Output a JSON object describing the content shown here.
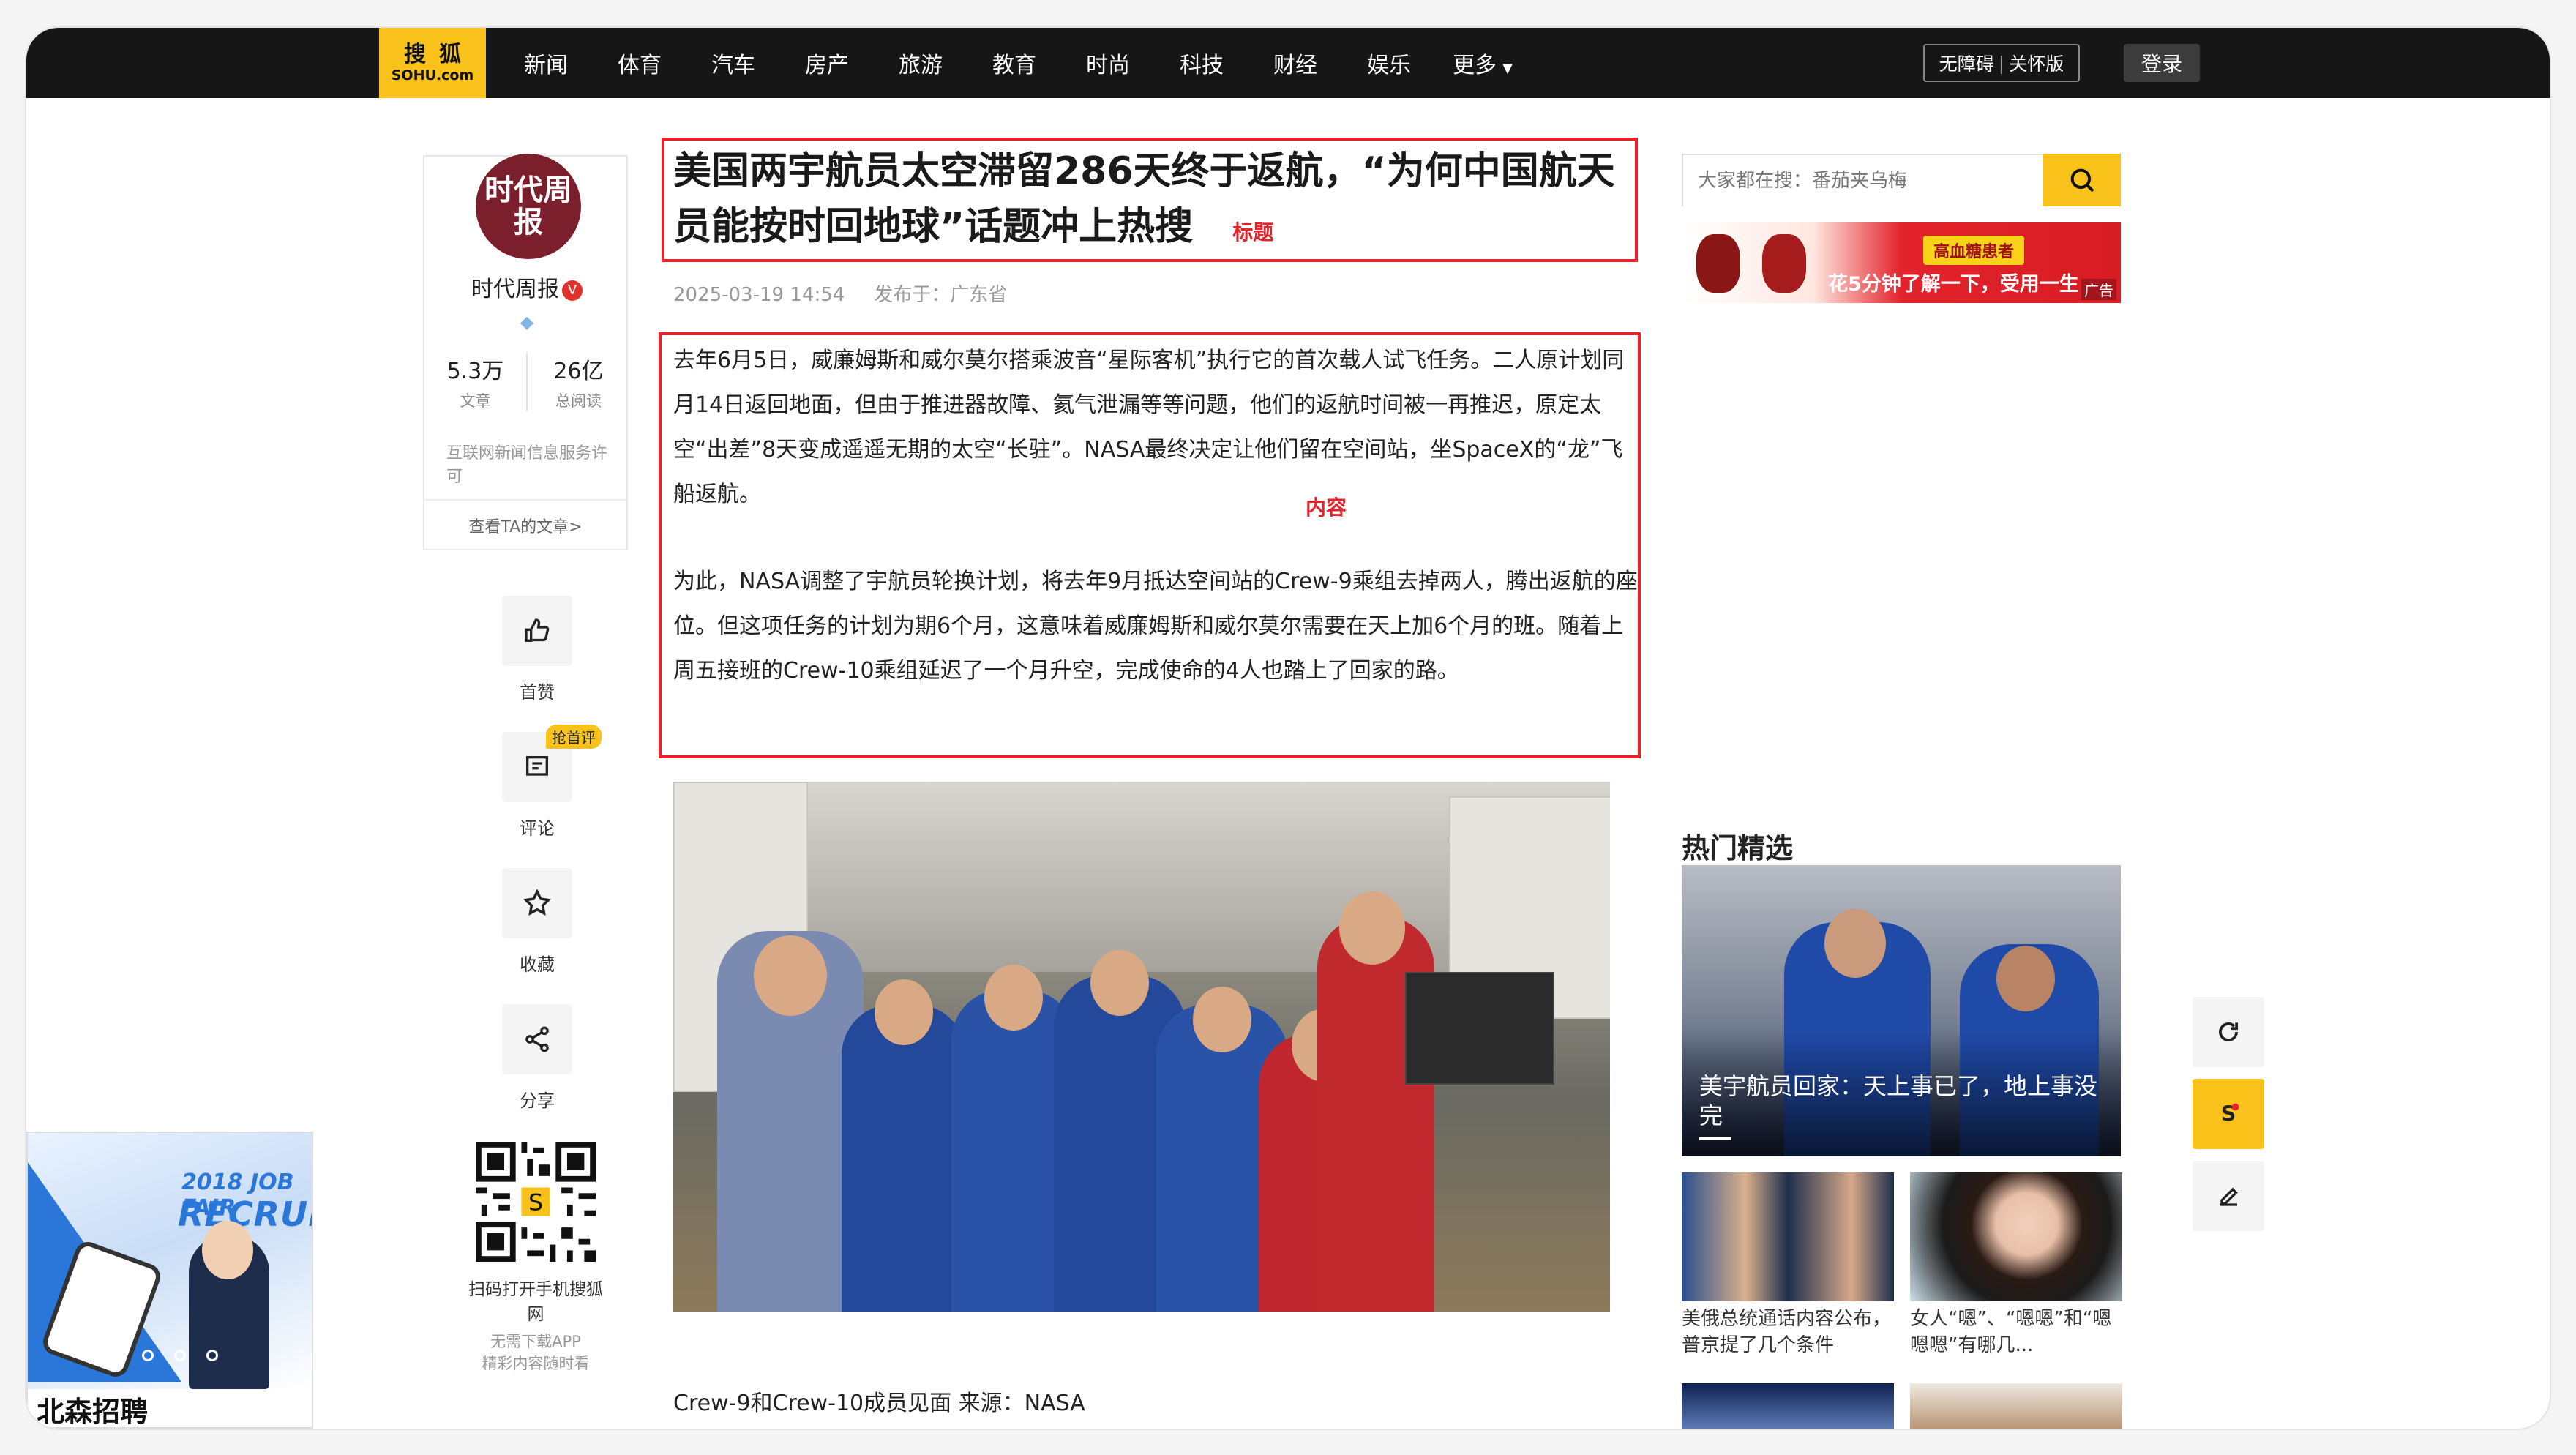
{
  "brand": {
    "logo_line1": "搜狐",
    "logo_line2": "SOHU.com"
  },
  "nav": {
    "items": [
      "新闻",
      "体育",
      "汽车",
      "房产",
      "旅游",
      "教育",
      "时尚",
      "科技",
      "财经",
      "娱乐"
    ],
    "more": "更多",
    "accessibility": "无障碍",
    "care_mode": "关怀版",
    "login": "登录"
  },
  "author": {
    "avatar_text": "时代周报",
    "name": "时代周报",
    "articles_value": "5.3万",
    "articles_label": "文章",
    "reads_value": "26亿",
    "reads_label": "总阅读",
    "license": "互联网新闻信息服务许可",
    "view_more": "查看TA的文章>"
  },
  "actions": {
    "like": "首赞",
    "comment": "评论",
    "comment_badge": "抢首评",
    "favorite": "收藏",
    "share": "分享"
  },
  "qr": {
    "line1": "扫码打开手机搜狐网",
    "line2": "无需下载APP",
    "line3": "精彩内容随时看"
  },
  "float_ad": {
    "jobfair": "2018 JOB FAIR",
    "recruit": "RECRUIT",
    "caption": "北森招聘"
  },
  "article": {
    "title": "美国两宇航员太空滞留286天终于返航，“为何中国航天员能按时回地球”话题冲上热搜",
    "title_label": "标题",
    "date": "2025-03-19 14:54",
    "published_in": "发布于：广东省",
    "paragraph1": "去年6月5日，威廉姆斯和威尔莫尔搭乘波音“星际客机”执行它的首次载人试飞任务。二人原计划同月14日返回地面，但由于推进器故障、氦气泄漏等等问题，他们的返航时间被一再推迟，原定太空“出差”8天变成遥遥无期的太空“长驻”。NASA最终决定让他们留在空间站，坐SpaceX的“龙”飞船返航。",
    "content_label": "内容",
    "paragraph2": "为此，NASA调整了宇航员轮换计划，将去年9月抵达空间站的Crew-9乘组去掉两人，腾出返航的座位。但这项任务的计划为期6个月，这意味着威廉姆斯和威尔莫尔需要在天上加6个月的班。随着上周五接班的Crew-10乘组延迟了一个月升空，完成使命的4人也踏上了回家的路。",
    "image_caption": "Crew-9和Crew-10成员见面 来源：NASA"
  },
  "sidebar": {
    "search_placeholder": "大家都在搜：番茄夹乌梅",
    "ad_badge": "高血糖患者",
    "ad_text": "花5分钟了解一下，受用一生",
    "ad_tag": "广告",
    "hot_title": "热门精选",
    "hot_main_caption": "美宇航员回家：天上事已了，地上事没完",
    "hot_item1": "美俄总统通话内容公布，普京提了几个条件",
    "hot_item2": "女人“嗯”、“嗯嗯”和“嗯嗯嗯”有哪几..."
  },
  "colors": {
    "accent": "#f8c21b",
    "annotation_red": "#e8222a",
    "nav_bg": "#161616"
  }
}
